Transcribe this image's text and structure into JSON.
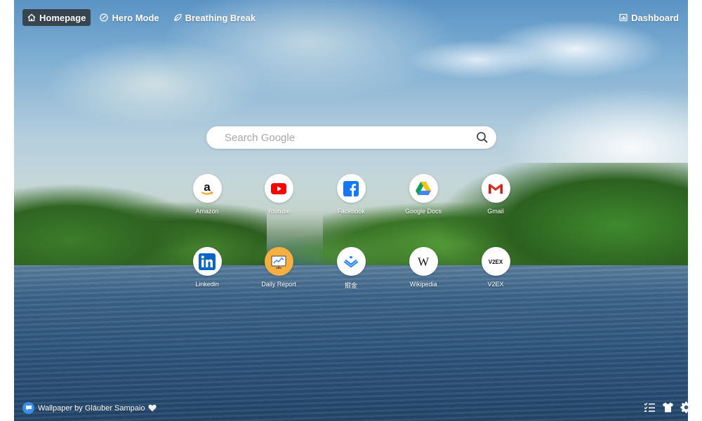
{
  "nav": {
    "items": [
      {
        "label": "Homepage",
        "icon": "home-icon",
        "active": true
      },
      {
        "label": "Hero Mode",
        "icon": "target-icon",
        "active": false
      },
      {
        "label": "Breathing Break",
        "icon": "leaf-icon",
        "active": false
      }
    ],
    "dashboard_label": "Dashboard"
  },
  "search": {
    "placeholder": "Search Google",
    "value": ""
  },
  "shortcuts": [
    {
      "label": "Amazon",
      "icon": "amazon-icon"
    },
    {
      "label": "Youtube",
      "icon": "youtube-icon"
    },
    {
      "label": "Facebook",
      "icon": "facebook-icon"
    },
    {
      "label": "Google Docs",
      "icon": "google-drive-icon"
    },
    {
      "label": "Gmail",
      "icon": "gmail-icon"
    },
    {
      "label": "Linkedin",
      "icon": "linkedin-icon"
    },
    {
      "label": "Daily Report",
      "icon": "daily-report-icon"
    },
    {
      "label": "掘金",
      "icon": "juejin-icon"
    },
    {
      "label": "Wikipedia",
      "icon": "wikipedia-icon"
    },
    {
      "label": "V2EX",
      "icon": "v2ex-icon"
    }
  ],
  "footer": {
    "credit": "Wallpaper by Gláuber Sampaio",
    "tools": [
      "checklist-icon",
      "tshirt-icon",
      "gear-icon"
    ]
  },
  "icon_text": {
    "amazon": "a",
    "wikipedia": "W",
    "v2ex": "V2EX"
  },
  "colors": {
    "youtube": "#ff0000",
    "facebook": "#1877f2",
    "linkedin": "#0a66c2",
    "gmail": "#d93025",
    "daily_report": "#f5b041",
    "juejin": "#1e80ff",
    "credit_bubble": "#3a8ee8"
  }
}
